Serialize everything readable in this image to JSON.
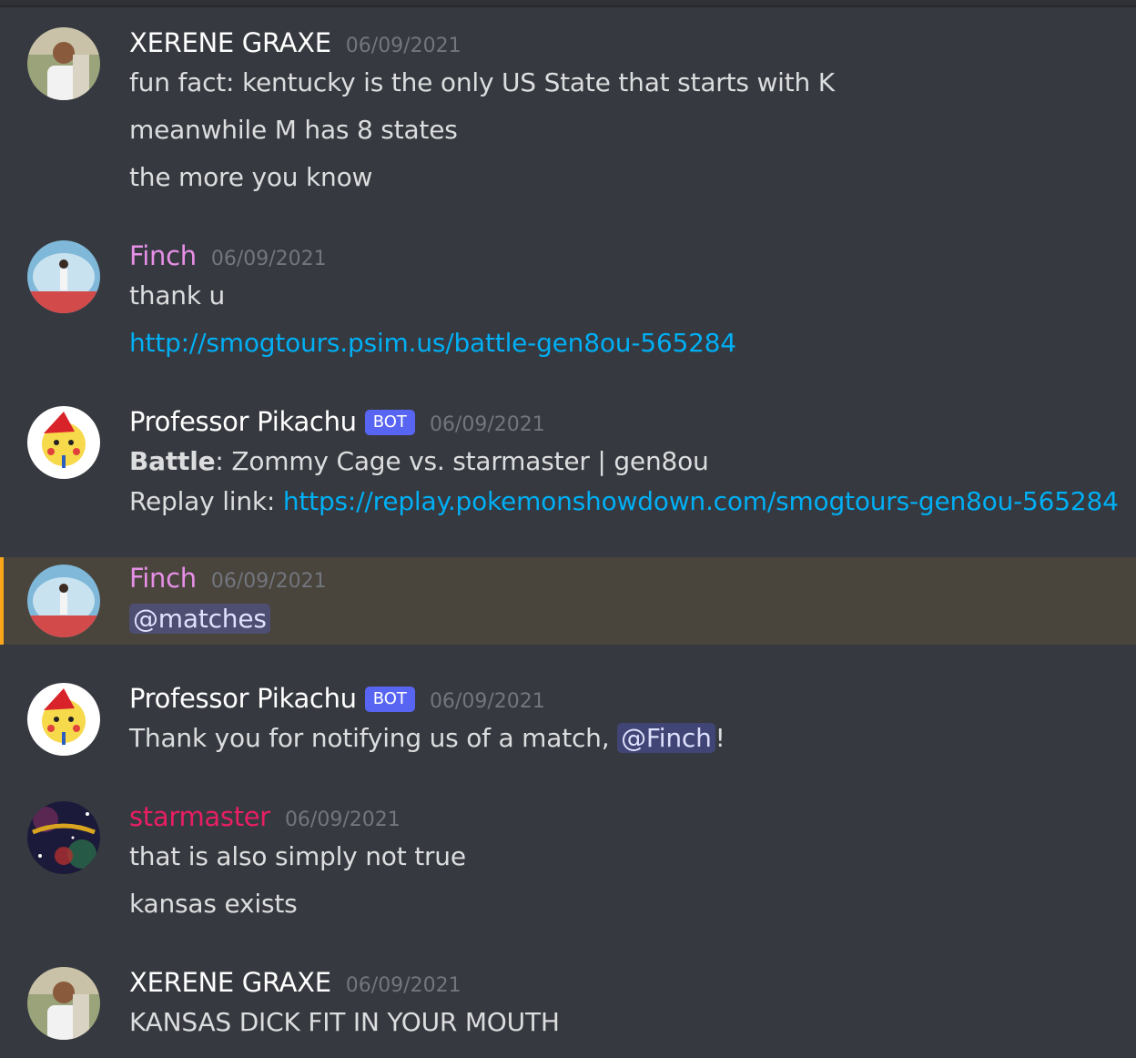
{
  "colors": {
    "background": "#36393f",
    "mention_highlight": "#49443c",
    "mention_bar": "#faa61a",
    "link": "#00aff4",
    "bot_tag": "#5865f2",
    "name_default": "#ffffff",
    "name_finch": "#e68fe6",
    "name_starmaster": "#e91e63"
  },
  "messages": [
    {
      "author": "XERENE GRAXE",
      "timestamp": "06/09/2021",
      "lines": [
        "fun fact: kentucky is the only US State that starts with K",
        "meanwhile M has 8 states",
        "the more you know"
      ]
    },
    {
      "author": "Finch",
      "timestamp": "06/09/2021",
      "lines": [
        "thank u"
      ],
      "link": "http://smogtours.psim.us/battle-gen8ou-565284"
    },
    {
      "author": "Professor Pikachu",
      "bot_tag": "BOT",
      "timestamp": "06/09/2021",
      "battle_label": "Battle",
      "battle_text": ": Zommy Cage vs. starmaster | gen8ou",
      "replay_label": "Replay link: ",
      "replay_link": "https://replay.pokemonshowdown.com/smogtours-gen8ou-565284"
    },
    {
      "author": "Finch",
      "timestamp": "06/09/2021",
      "mention": "@matches"
    },
    {
      "author": "Professor Pikachu",
      "bot_tag": "BOT",
      "timestamp": "06/09/2021",
      "text_before": "Thank you for notifying us of a match, ",
      "mention": "@Finch",
      "text_after": "!"
    },
    {
      "author": "starmaster",
      "timestamp": "06/09/2021",
      "lines": [
        "that is also simply not true",
        "kansas exists"
      ]
    },
    {
      "author": "XERENE GRAXE",
      "timestamp": "06/09/2021",
      "lines": [
        "KANSAS DICK FIT IN YOUR MOUTH"
      ]
    }
  ]
}
